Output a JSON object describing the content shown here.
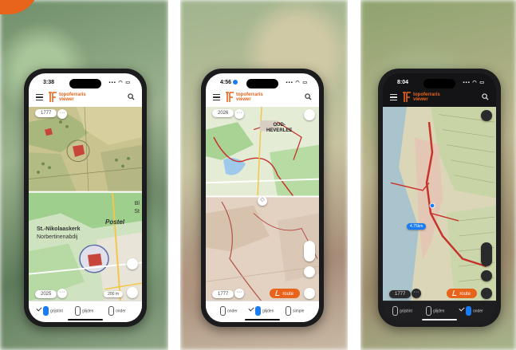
{
  "screens": [
    {
      "time": "3:38",
      "brand_line1": "topoferraris",
      "brand_line2": "viewer",
      "year_pill": "1777",
      "year_pill_bottom": "2025",
      "scale_label": "200 m",
      "map_labels": [
        "St.-Nikolaaskerk",
        "Norbertinenabdij",
        "Postel",
        "Bl",
        "St"
      ],
      "tabs": [
        "grijstint",
        "glijden",
        "onder"
      ],
      "active_tab": 0
    },
    {
      "time": "4:56",
      "brand_line1": "topoferraris",
      "brand_line2": "viewer",
      "year_pill": "2026",
      "year_pill_bottom": "1777",
      "map_labels": [
        "OUD-",
        "HEVERLEE"
      ],
      "route_button": "route",
      "tabs": [
        "onder",
        "glijden",
        "simple"
      ],
      "active_tab": 1
    },
    {
      "time": "8:04",
      "brand_line1": "topoferraris",
      "brand_line2": "viewer",
      "year_pill_bottom": "1777",
      "distance_label": "4.75km",
      "route_button": "route",
      "tabs": [
        "grijstint",
        "glijden",
        "onder"
      ],
      "active_tab": 2
    }
  ],
  "colors": {
    "accent": "#e8641b",
    "route_red": "#c7322a",
    "marker_blue": "#1a7cf2"
  },
  "icons": [
    "menu-icon",
    "search-icon",
    "more-icon",
    "layers-icon",
    "locate-icon",
    "zoom-in-icon",
    "zoom-out-icon",
    "walk-icon",
    "check-icon",
    "chart-icon"
  ]
}
